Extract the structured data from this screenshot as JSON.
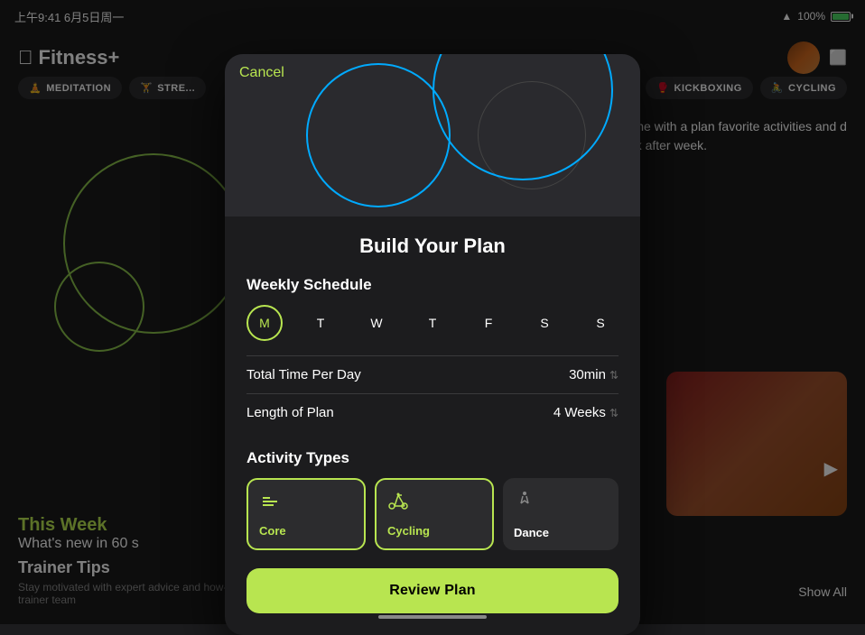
{
  "statusBar": {
    "time": "上午9:41  6月5日周一",
    "wifi": "WiFi",
    "battery": "100%"
  },
  "app": {
    "logo": "Fitness+",
    "apple_symbol": ""
  },
  "categories": {
    "left": [
      {
        "id": "meditation",
        "label": "MEDITATION",
        "icon": "🧘"
      },
      {
        "id": "strength",
        "label": "STRE...",
        "icon": "🏋"
      }
    ],
    "right": [
      {
        "id": "kickboxing",
        "label": "KICKBOXING",
        "icon": "🥊"
      },
      {
        "id": "cycling",
        "label": "CYCLING",
        "icon": "🚴"
      }
    ]
  },
  "rightPanel": {
    "text": "routine with a plan\nfavorite activities and\nd week after week."
  },
  "thisWeek": {
    "heading": "This Week",
    "subheading": "What's new in 60 s"
  },
  "trainerTips": {
    "title": "Trainer Tips",
    "subtitle": "Stay motivated with expert advice and how-to demos from the Fitness+ trainer team",
    "showAll": "Show All"
  },
  "modal": {
    "cancel": "Cancel",
    "title": "Build Your Plan",
    "weeklySchedule": {
      "label": "Weekly Schedule",
      "days": [
        {
          "letter": "M",
          "active": true
        },
        {
          "letter": "T",
          "active": false
        },
        {
          "letter": "W",
          "active": false
        },
        {
          "letter": "T",
          "active": false
        },
        {
          "letter": "F",
          "active": false
        },
        {
          "letter": "S",
          "active": false
        },
        {
          "letter": "S",
          "active": false
        }
      ],
      "totalTimeLabel": "Total Time Per Day",
      "totalTimeValue": "30min",
      "lengthLabel": "Length of Plan",
      "lengthValue": "4 Weeks"
    },
    "activityTypes": {
      "label": "Activity Types",
      "items": [
        {
          "id": "core",
          "name": "Core",
          "icon": "⊞",
          "selected": true
        },
        {
          "id": "cycling",
          "name": "Cycling",
          "icon": "🚴",
          "selected": true
        },
        {
          "id": "dance",
          "name": "Dance",
          "icon": "🕺",
          "selected": false
        }
      ]
    },
    "reviewBtn": "Review Plan"
  }
}
